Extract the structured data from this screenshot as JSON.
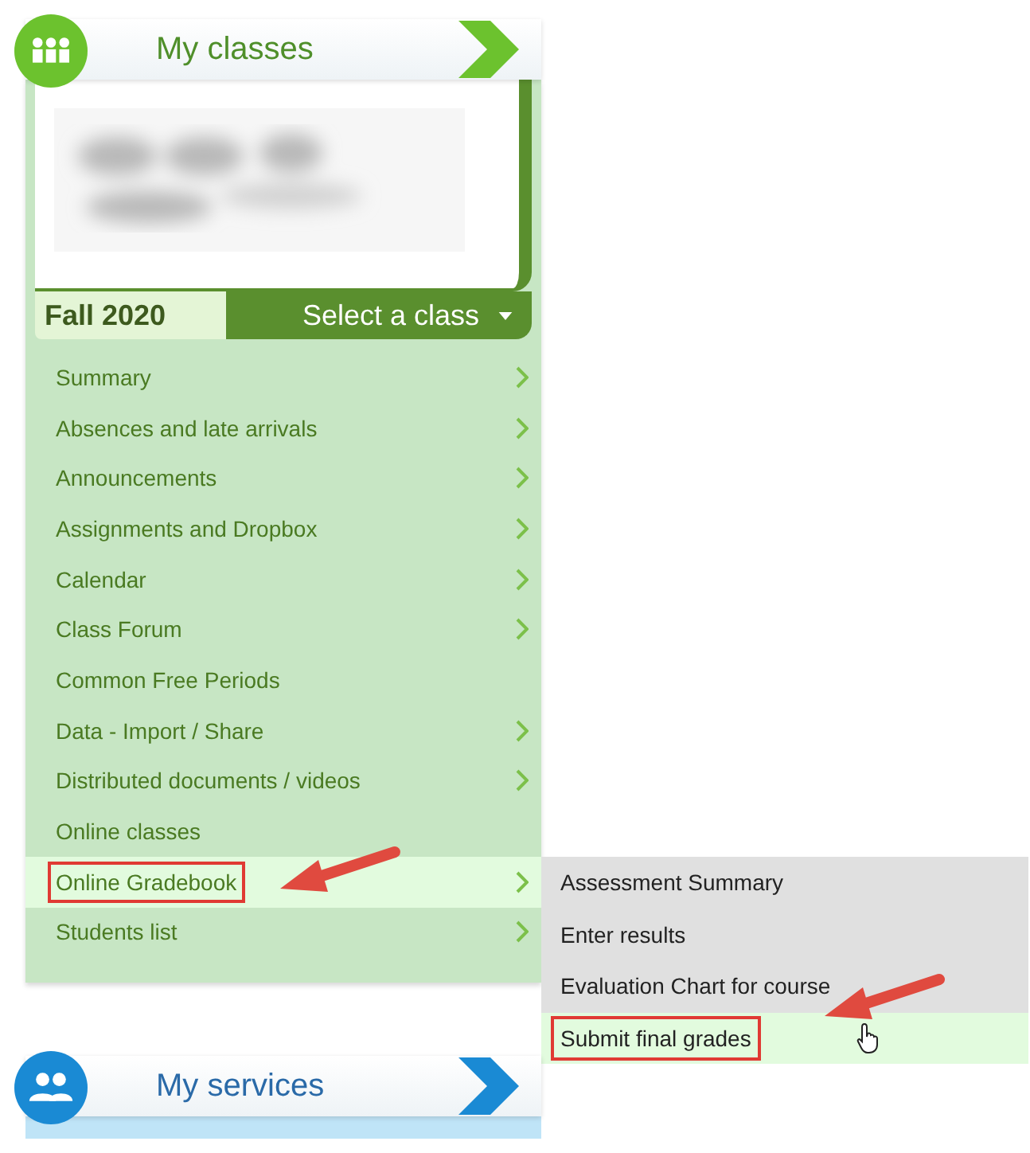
{
  "classes_panel": {
    "title": "My classes",
    "term": "Fall 2020",
    "class_selector": "Select a class",
    "menu": [
      {
        "label": "Summary",
        "has_submenu": true,
        "selected": false,
        "annotated": false
      },
      {
        "label": "Absences and late arrivals",
        "has_submenu": true,
        "selected": false,
        "annotated": false
      },
      {
        "label": "Announcements",
        "has_submenu": true,
        "selected": false,
        "annotated": false
      },
      {
        "label": "Assignments and Dropbox",
        "has_submenu": true,
        "selected": false,
        "annotated": false
      },
      {
        "label": "Calendar",
        "has_submenu": true,
        "selected": false,
        "annotated": false
      },
      {
        "label": "Class Forum",
        "has_submenu": true,
        "selected": false,
        "annotated": false
      },
      {
        "label": "Common Free Periods",
        "has_submenu": false,
        "selected": false,
        "annotated": false
      },
      {
        "label": "Data - Import / Share",
        "has_submenu": true,
        "selected": false,
        "annotated": false
      },
      {
        "label": "Distributed documents / videos",
        "has_submenu": true,
        "selected": false,
        "annotated": false
      },
      {
        "label": "Online classes",
        "has_submenu": false,
        "selected": false,
        "annotated": false
      },
      {
        "label": "Online Gradebook",
        "has_submenu": true,
        "selected": true,
        "annotated": true
      },
      {
        "label": "Students list",
        "has_submenu": true,
        "selected": false,
        "annotated": false
      }
    ]
  },
  "submenu": [
    {
      "label": "Assessment Summary",
      "selected": false,
      "annotated": false
    },
    {
      "label": "Enter results",
      "selected": false,
      "annotated": false
    },
    {
      "label": "Evaluation Chart for course",
      "selected": false,
      "annotated": false
    },
    {
      "label": "Submit final grades",
      "selected": true,
      "annotated": true
    }
  ],
  "services_panel": {
    "title": "My services"
  }
}
